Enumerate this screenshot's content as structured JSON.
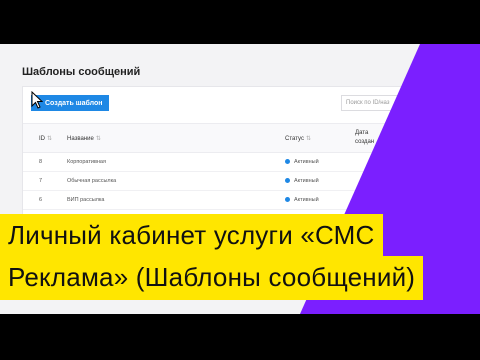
{
  "page": {
    "title": "Шаблоны сообщений"
  },
  "toolbar": {
    "create_label": "Создать шаблон",
    "search_placeholder": "Поиск по ID/наз"
  },
  "table": {
    "columns": [
      "ID",
      "Название",
      "Статус",
      "Дата создан"
    ],
    "rows": [
      {
        "id": "8",
        "name": "Корпоративная",
        "status": "Активный"
      },
      {
        "id": "7",
        "name": "Обычная рассылка",
        "status": "Активный"
      },
      {
        "id": "6",
        "name": "ВИП рассылка",
        "status": "Активный"
      }
    ]
  },
  "banner": {
    "line1": "Личный кабинет услуги «СМС",
    "line2": "Реклама» (Шаблоны сообщений)"
  },
  "colors": {
    "accent": "#1e88e5",
    "banner": "#ffe600",
    "purple": "#7b1fff"
  }
}
